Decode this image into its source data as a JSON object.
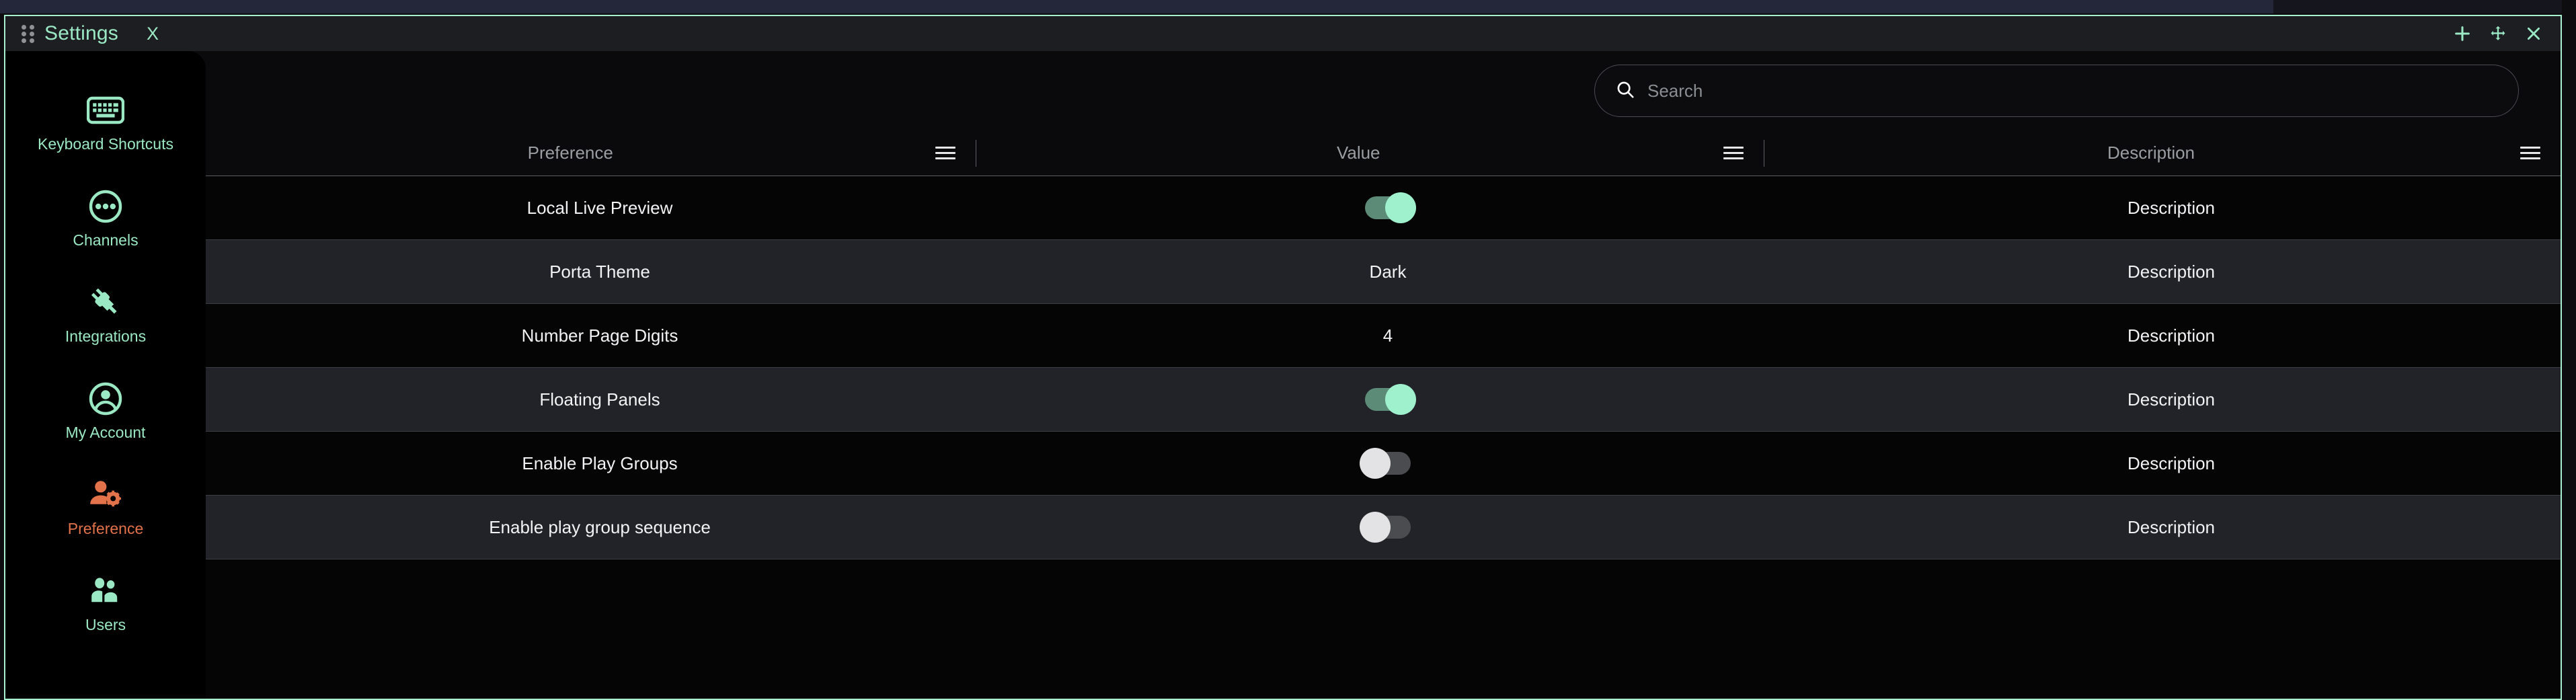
{
  "titlebar": {
    "drag_handle_icon": "drag-dots-icon",
    "tab_label": "Settings",
    "tab_close_label": "X",
    "controls": [
      {
        "name": "add-panel-button",
        "icon": "plus-icon"
      },
      {
        "name": "move-panel-button",
        "icon": "move-arrows-icon"
      },
      {
        "name": "close-panel-button",
        "icon": "close-x-icon"
      }
    ]
  },
  "colors": {
    "accent_mint": "#9be8c4",
    "accent_active": "#e2724a",
    "toggle_on_track": "#5c8c77",
    "toggle_on_knob": "#9ff0cc",
    "toggle_off_track": "#4a4c50",
    "toggle_off_knob": "#e3e3e5",
    "panel_border": "#a8f0cf",
    "row_even": "#212328",
    "row_odd": "#050506"
  },
  "sidebar": {
    "items": [
      {
        "label": "Keyboard Shortcuts",
        "icon": "keyboard-icon",
        "active": false
      },
      {
        "label": "Channels",
        "icon": "channels-dots-circle-icon",
        "active": false
      },
      {
        "label": "Integrations",
        "icon": "plug-icon",
        "active": false
      },
      {
        "label": "My Account",
        "icon": "user-circle-icon",
        "active": false
      },
      {
        "label": "Preference",
        "icon": "user-gear-icon",
        "active": true
      },
      {
        "label": "Users",
        "icon": "users-group-icon",
        "active": false
      }
    ]
  },
  "search": {
    "icon": "search-icon",
    "value": "",
    "placeholder": "Search"
  },
  "table": {
    "columns": [
      {
        "label": "Preference",
        "menu_icon": "hamburger-menu-icon",
        "has_divider": true
      },
      {
        "label": "Value",
        "menu_icon": "hamburger-menu-icon",
        "has_divider": true
      },
      {
        "label": "Description",
        "menu_icon": "hamburger-menu-icon",
        "has_divider": false
      }
    ],
    "rows": [
      {
        "preference": "Local Live Preview",
        "value_type": "toggle",
        "value": "on",
        "description": "Description"
      },
      {
        "preference": "Porta Theme",
        "value_type": "text",
        "value": "Dark",
        "description": "Description"
      },
      {
        "preference": "Number Page Digits",
        "value_type": "text",
        "value": "4",
        "description": "Description"
      },
      {
        "preference": "Floating Panels",
        "value_type": "toggle",
        "value": "on",
        "description": "Description"
      },
      {
        "preference": "Enable Play Groups",
        "value_type": "toggle",
        "value": "off",
        "description": "Description"
      },
      {
        "preference": "Enable play group sequence",
        "value_type": "toggle",
        "value": "off",
        "description": "Description"
      }
    ]
  }
}
